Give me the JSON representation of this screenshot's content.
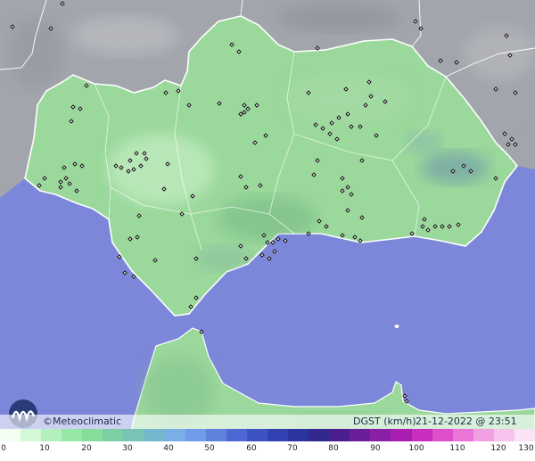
{
  "map": {
    "colors": {
      "sea": "#7d87d9",
      "land_outside": "#a3a5ac",
      "land_region": "#9ad89b",
      "borders": "#ffffff",
      "stations": "#111111"
    },
    "stations_icon": "diamond-marker-icon"
  },
  "info_bar": {
    "brand": "©Meteoclimatic",
    "product": "DGST (km/h)",
    "timestamp": "21-12-2022 @ 23:51 UTC"
  },
  "legend": {
    "ticks": [
      "0",
      "10",
      "20",
      "30",
      "40",
      "50",
      "60",
      "70",
      "80",
      "90",
      "100",
      "110",
      "120",
      "130"
    ],
    "colors": [
      "#f2fff2",
      "#d2f8d6",
      "#b4f0bd",
      "#97e8a6",
      "#86dc9a",
      "#7ccfa4",
      "#78c2b8",
      "#74b8cf",
      "#7aaee6",
      "#6f9be8",
      "#5e82de",
      "#4d68d2",
      "#3d53c4",
      "#3342b2",
      "#2b34a0",
      "#33288e",
      "#4a1f8d",
      "#6a1f99",
      "#8b1fa6",
      "#aa1fb3",
      "#c82fbf",
      "#dd4fca",
      "#ea75d6",
      "#f29fe2",
      "#f7c3ec",
      "#fbe2f6"
    ]
  }
}
